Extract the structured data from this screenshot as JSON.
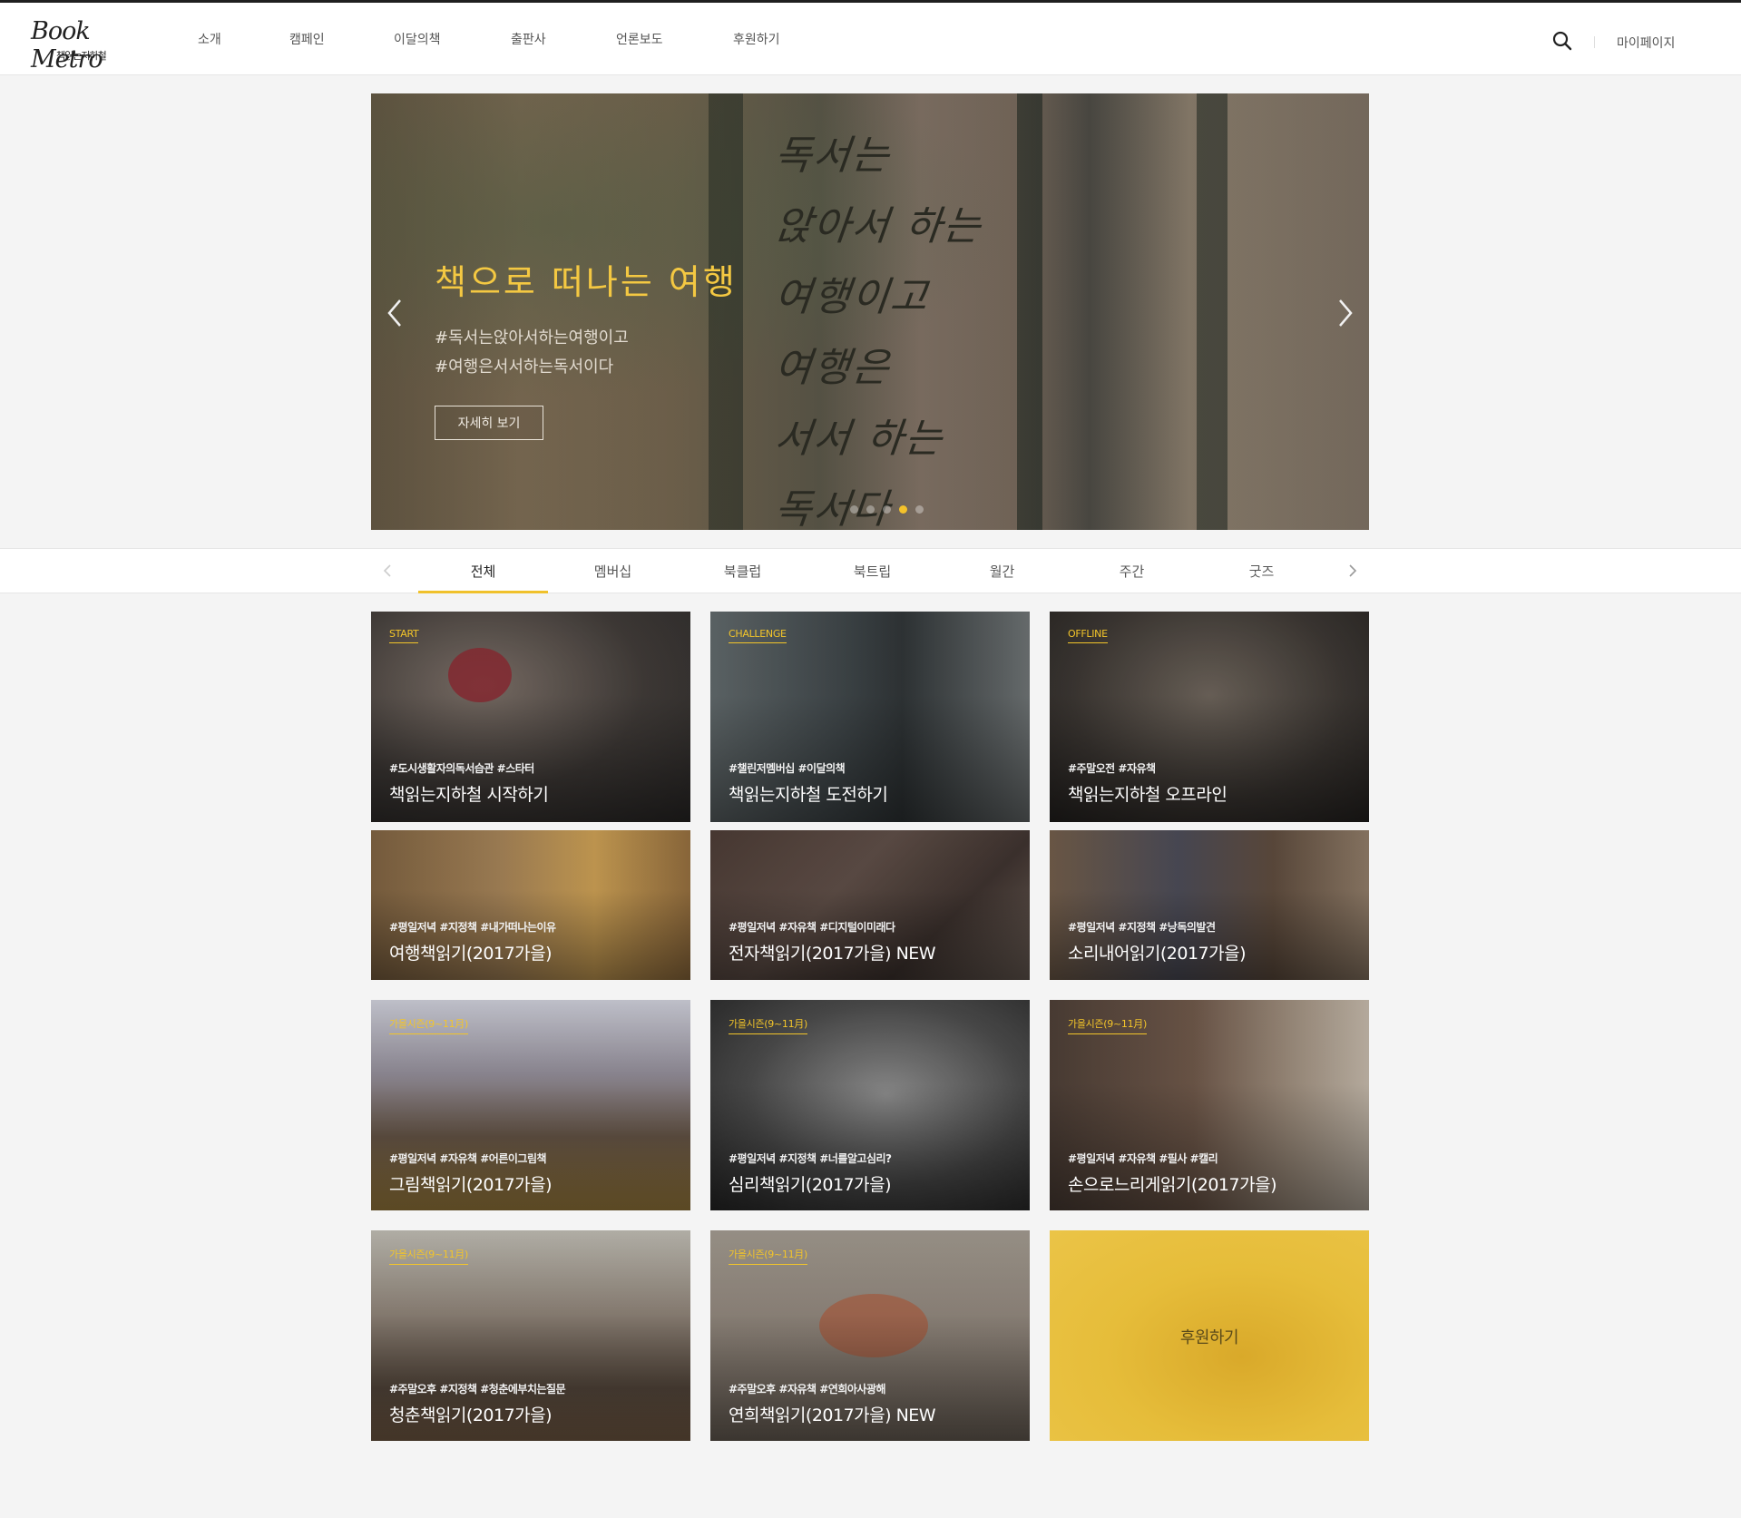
{
  "header": {
    "logo_main": "Book Metro",
    "logo_sub": "책읽는지하철",
    "nav": [
      "소개",
      "캠페인",
      "이달의책",
      "출판사",
      "언론보도",
      "후원하기"
    ],
    "search_icon": "search-icon",
    "mypage_label": "마이페이지"
  },
  "hero": {
    "title": "책으로 떠나는 여행",
    "sub1": "#독서는앉아서하는여행이고",
    "sub2": "#여행은서서하는독서이다",
    "button_label": "자세히 보기",
    "script_lines": [
      "독서는",
      "앉아서 하는",
      "여행이고",
      "여행은",
      "서서 하는",
      "독서다"
    ],
    "dots": 5,
    "active_dot": 4,
    "accent_color": "#f4c842"
  },
  "tabs": {
    "items": [
      "전체",
      "멤버십",
      "북클럽",
      "북트립",
      "월간",
      "주간",
      "굿즈"
    ],
    "active": 0,
    "accent_color": "#f0c12b"
  },
  "cards": [
    {
      "badge": "START",
      "tags": "#도시생활자의독서습관 #스타터",
      "title": "책읽는지하철 시작하기"
    },
    {
      "badge": "CHALLENGE",
      "tags": "#챌린저멤버십 #이달의책",
      "title": "책읽는지하철 도전하기"
    },
    {
      "badge": "OFFLINE",
      "tags": "#주말오전 #자유책",
      "title": "책읽는지하철 오프라인"
    },
    {
      "badge": "",
      "tags": "#평일저녁 #지정책 #내가떠나는이유",
      "title": "여행책읽기(2017가을)"
    },
    {
      "badge": "",
      "tags": "#평일저녁 #자유책 #디지털이미래다",
      "title": "전자책읽기(2017가을) NEW"
    },
    {
      "badge": "",
      "tags": "#평일저녁 #지정책 #낭독의발견",
      "title": "소리내어읽기(2017가을)"
    },
    {
      "badge": "가을시즌(9~11月)",
      "tags": "#평일저녁 #자유책 #어른이그림책",
      "title": "그림책읽기(2017가을)"
    },
    {
      "badge": "가을시즌(9~11月)",
      "tags": "#평일저녁 #지정책 #너를알고심리?",
      "title": "심리책읽기(2017가을)"
    },
    {
      "badge": "가을시즌(9~11月)",
      "tags": "#평일저녁 #자유책 #필사 #캘리",
      "title": "손으로느리게읽기(2017가을)"
    },
    {
      "badge": "가을시즌(9~11月)",
      "tags": "#주말오후 #지정책 #청춘에부치는질문",
      "title": "청춘책읽기(2017가을)"
    },
    {
      "badge": "가을시즌(9~11月)",
      "tags": "#주말오후 #자유책 #연희아사광해",
      "title": "연희책읽기(2017가을) NEW"
    }
  ],
  "donate_card": {
    "title": "후원하기",
    "color": "#e3b92f"
  }
}
